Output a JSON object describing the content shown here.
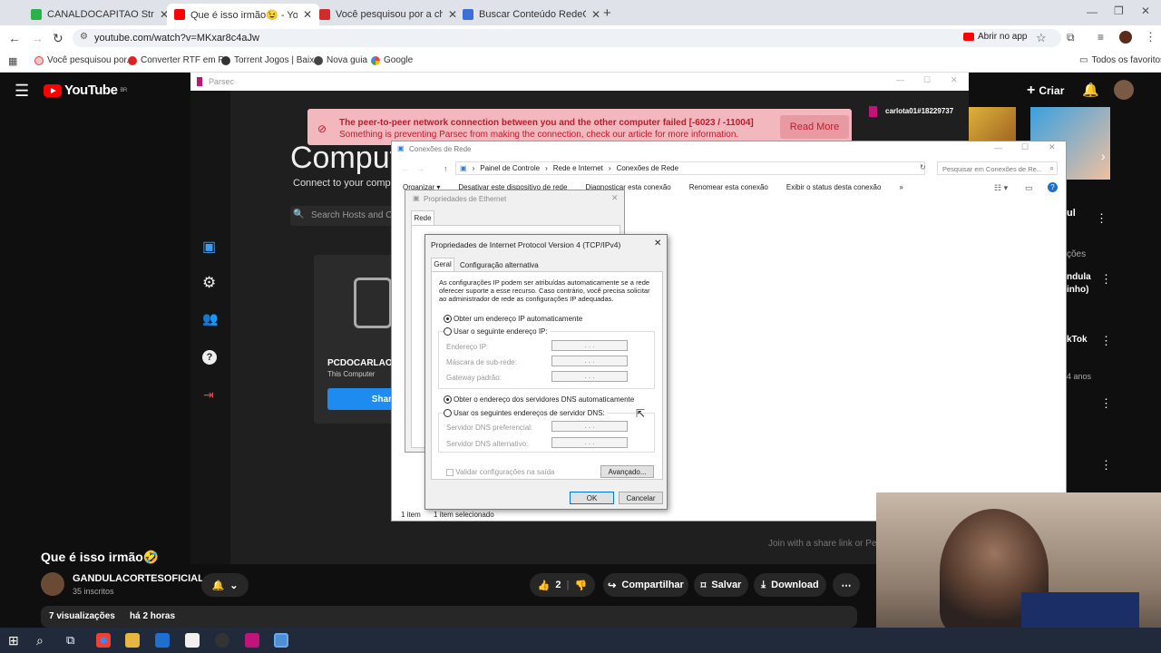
{
  "browser": {
    "tabs": [
      {
        "title": "CANALDOCAPITAO Stream - W",
        "color": "#2bb24c"
      },
      {
        "title": "Que é isso irmão😉 - YouTube",
        "color": "#ff0000"
      },
      {
        "title": "Você pesquisou por a chave m",
        "color": "#d12c2c"
      },
      {
        "title": "Buscar Conteúdo RedeCanais: c",
        "color": "#3a6fd8"
      }
    ],
    "url": "youtube.com/watch?v=MKxar8c4aJw",
    "open_in_app": "Abrir no app",
    "bookmarks": [
      "Você pesquisou por...",
      "Converter RTF em P...",
      "Torrent Jogos | Baix...",
      "Nova guia",
      "Google"
    ],
    "all_bookmarks": "Todos os favoritos"
  },
  "youtube": {
    "logo": "YouTube",
    "region": "BR",
    "create_label": "Criar",
    "video_title": "Que é isso irmão🤣",
    "channel_name": "GANDULACORTESOFICIAL",
    "subscribers": "35 inscritos",
    "like_count": "2",
    "share_label": "Compartilhar",
    "save_label": "Salvar",
    "download_label": "Download",
    "views": "7 visualizações",
    "uploaded": "há 2 horas",
    "side_texts": [
      "ul",
      "ções",
      "ndula",
      "inho)",
      "kTok",
      "4 anos"
    ]
  },
  "parsec": {
    "window_title": "Parsec",
    "user": "carlota01#18229737",
    "heading": "Comput",
    "subheading": "Connect to your comput",
    "search_placeholder": "Search Hosts and Co",
    "computer_name": "PCDOCARLAO",
    "computer_sub": "This Computer",
    "share_btn": "Shar",
    "banner_line1": "The peer-to-peer network connection between you and the other computer failed [-6023 / -11004]",
    "banner_line2": "Something is preventing Parsec from making the connection, check our article for more information.",
    "read_more": "Read More",
    "footer_hint": "Join with a share link or Pe"
  },
  "explorer": {
    "title": "Conexões de Rede",
    "breadcrumb": [
      "Painel de Controle",
      "Rede e Internet",
      "Conexões de Rede"
    ],
    "search_placeholder": "Pesquisar em Conexões de Re...",
    "toolbar": [
      "Organizar ▾",
      "Desativar este dispositivo de rede",
      "Diagnosticar esta conexão",
      "Renomear esta conexão",
      "Exibir o status desta conexão",
      "»"
    ],
    "status_items": "1 item",
    "status_selected": "1 item selecionado"
  },
  "eth_props": {
    "title": "Propriedades de Ethernet",
    "tab": "Rede"
  },
  "ipv4": {
    "title": "Propriedades de Internet Protocol Version 4 (TCP/IPv4)",
    "tab_general": "Geral",
    "tab_alt": "Configuração alternativa",
    "description": "As configurações IP podem ser atribuídas automaticamente se a rede oferecer suporte a esse recurso. Caso contrário, você precisa solicitar ao administrador de rede as configurações IP adequadas.",
    "radio_auto_ip": "Obter um endereço IP automaticamente",
    "radio_manual_ip": "Usar o seguinte endereço IP:",
    "label_ip": "Endereço IP:",
    "label_mask": "Máscara de sub-rede:",
    "label_gateway": "Gateway padrão:",
    "radio_auto_dns": "Obter o endereço dos servidores DNS automaticamente",
    "radio_manual_dns": "Usar os seguintes endereços de servidor DNS:",
    "label_dns1": "Servidor DNS preferencial:",
    "label_dns2": "Servidor DNS alternativo:",
    "ip_placeholder": ". . .",
    "validate": "Validar configurações na saída",
    "advanced": "Avançado...",
    "ok": "OK",
    "cancel": "Cancelar"
  }
}
